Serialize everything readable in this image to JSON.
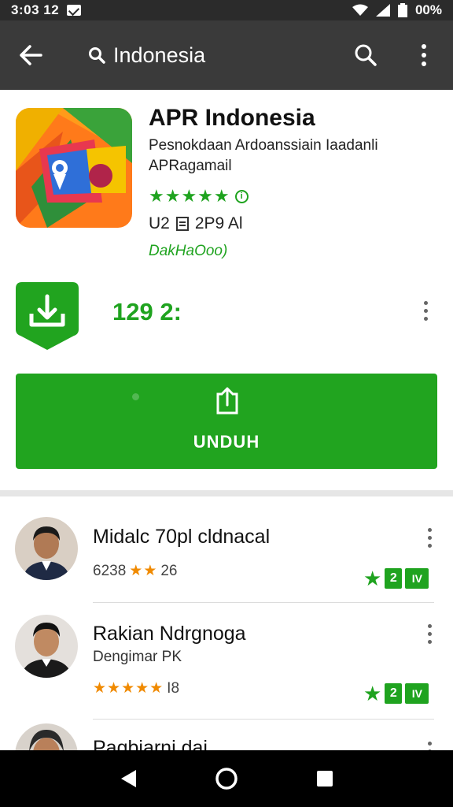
{
  "status_bar": {
    "time": "3:03 12",
    "battery": "00%",
    "notification_icon": "mail-icon"
  },
  "app_bar": {
    "search_query": "Indonesia",
    "icons": [
      "back-arrow-icon",
      "search-icon",
      "search-icon",
      "overflow-menu-icon"
    ]
  },
  "app": {
    "title": "APR Indonesia",
    "developer_line1": "Pesnokdaan Ardoanssiain Iaadanli",
    "developer_line2": "APRagamail",
    "stars": "★★★★★",
    "meta_left": "U2",
    "meta_right": "2P9  Al",
    "ads_label": "DakHaOoo)",
    "size": "129 2:",
    "install_label": "UNDUH"
  },
  "related": [
    {
      "title": "Midalc 70pl cldnacal",
      "rating_prefix": "6238",
      "stars": "★★",
      "rating_suffix": "26",
      "badge_num": "2",
      "badge_text": "IV"
    },
    {
      "title": "Rakian Ndrgnoga",
      "subtitle": "Dengimar PK",
      "stars": "★★★★★",
      "rating_suffix": "I8",
      "badge_num": "2",
      "badge_text": "IV"
    },
    {
      "title": "Pagbiarni dai"
    }
  ],
  "colors": {
    "accent_green": "#21a41f",
    "app_bar": "#3a3a3a",
    "star_orange": "#f08a00"
  }
}
